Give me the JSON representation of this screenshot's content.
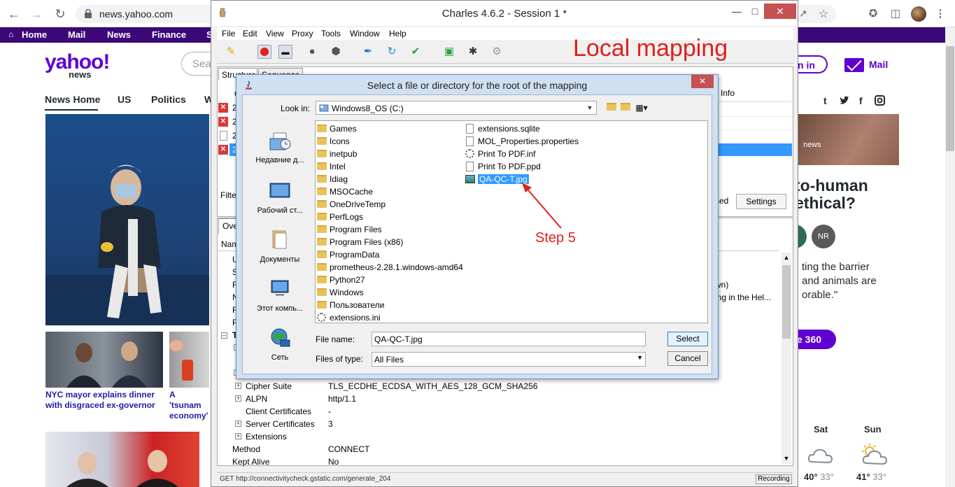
{
  "browser": {
    "url": "news.yahoo.com"
  },
  "yahoo": {
    "nav": [
      "Home",
      "Mail",
      "News",
      "Finance",
      "S"
    ],
    "search_placeholder": "Sea",
    "logo_main": "yahoo!",
    "logo_sub": "news",
    "subnav": [
      "News Home",
      "US",
      "Politics",
      "W"
    ],
    "captions": [
      "NYC mayor explains dinner with disgraced ex-governor",
      "A 'tsunam economy'"
    ],
    "signin": "n in",
    "mail": "Mail",
    "social": [
      "t",
      "y",
      "f",
      "o"
    ],
    "rt_news": "news",
    "rt_headline_1": "to-human",
    "rt_headline_2": "ethical?",
    "rt_avatar": "NR",
    "rt_body": [
      "ting the barrier",
      "and animals are",
      "orable.\""
    ],
    "rt_button": "e 360",
    "weather": [
      {
        "day": "Sat",
        "high": "40°",
        "low": "33°"
      },
      {
        "day": "Sun",
        "high": "41°",
        "low": "33°"
      }
    ]
  },
  "charles": {
    "title": "Charles 4.6.2 - Session 1 *",
    "menu": [
      "File",
      "Edit",
      "View",
      "Proxy",
      "Tools",
      "Window",
      "Help"
    ],
    "tabs": [
      "Structure",
      "Sequence"
    ],
    "info_header": "Info",
    "sed_label": "sed",
    "settings_label": "Settings",
    "filter_label": "Filte",
    "over_label": "Ove",
    "name_label": "Nam",
    "left_letters": [
      "U",
      "S",
      "F",
      "N",
      "R",
      "P"
    ],
    "right_text_1": "wn)",
    "right_text_2": "ing in the Hel...",
    "tree_letter": "T",
    "properties": [
      {
        "name": "Cipher Suite",
        "value": "TLS_ECDHE_ECDSA_WITH_AES_128_GCM_SHA256",
        "expand": true
      },
      {
        "name": "ALPN",
        "value": "http/1.1",
        "expand": true
      },
      {
        "name": "Client Certificates",
        "value": "-",
        "expand": false
      },
      {
        "name": "Server Certificates",
        "value": "3",
        "expand": true
      },
      {
        "name": "Extensions",
        "value": "",
        "expand": true
      },
      {
        "name": "Method",
        "value": "CONNECT",
        "expand": false
      },
      {
        "name": "Kept Alive",
        "value": "No",
        "expand": false
      }
    ],
    "status": "GET http://connectivitycheck.gstatic.com/generate_204",
    "recording": "Recording",
    "row_prefix": "2"
  },
  "annotation": {
    "title": "Local mapping",
    "step": "Step 5"
  },
  "dialog": {
    "title": "Select a file or directory for the root of the mapping",
    "look_in_label": "Look in:",
    "look_in_value": "Windows8_OS (C:)",
    "places": [
      "Недавние д...",
      "Рабочий ст...",
      "Документы",
      "Этот компь...",
      "Сеть"
    ],
    "col1": [
      {
        "name": "Games",
        "type": "folder"
      },
      {
        "name": "Icons",
        "type": "folder"
      },
      {
        "name": "inetpub",
        "type": "folder"
      },
      {
        "name": "Intel",
        "type": "folder"
      },
      {
        "name": "Idiag",
        "type": "folder"
      },
      {
        "name": "MSOCache",
        "type": "folder"
      },
      {
        "name": "OneDriveTemp",
        "type": "folder"
      },
      {
        "name": "PerfLogs",
        "type": "folder"
      },
      {
        "name": "Program Files",
        "type": "folder"
      },
      {
        "name": "Program Files (x86)",
        "type": "folder"
      },
      {
        "name": "ProgramData",
        "type": "folder"
      },
      {
        "name": "prometheus-2.28.1.windows-amd64",
        "type": "folder"
      },
      {
        "name": "Python27",
        "type": "folder"
      },
      {
        "name": "Windows",
        "type": "folder"
      },
      {
        "name": "Пользователи",
        "type": "folder"
      },
      {
        "name": "extensions.ini",
        "type": "gear"
      }
    ],
    "col2": [
      {
        "name": "extensions.sqlite",
        "type": "file"
      },
      {
        "name": "MOL_Properties.properties",
        "type": "file"
      },
      {
        "name": "Print To PDF.inf",
        "type": "gear"
      },
      {
        "name": "Print To PDF.ppd",
        "type": "file"
      },
      {
        "name": "QA-QC-T.jpg",
        "type": "jpg",
        "selected": true
      }
    ],
    "file_name_label": "File name:",
    "file_name_value": "QA-QC-T.jpg",
    "files_of_type_label": "Files of type:",
    "files_of_type_value": "All Files",
    "select_label": "Select",
    "cancel_label": "Cancel"
  },
  "colors": {
    "yahoo_purple": "#6001d2",
    "annotation_red": "#e0201a",
    "selection_blue": "#3399ff"
  }
}
